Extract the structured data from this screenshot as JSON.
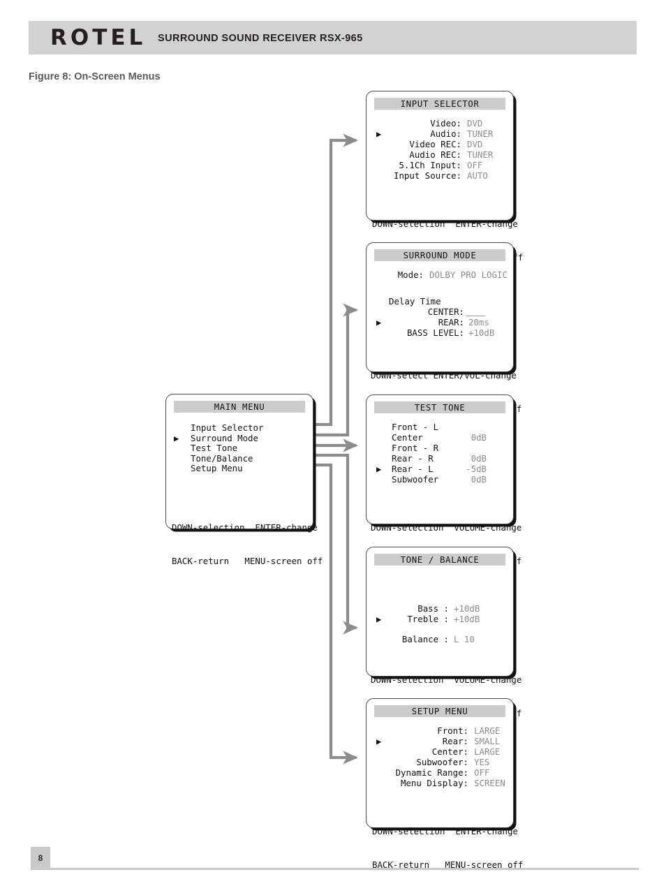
{
  "header": {
    "brand": "ROTEL",
    "model_line": "SURROUND SOUND RECEIVER  RSX-965"
  },
  "figure": {
    "caption": "Figure 8: On-Screen Menus"
  },
  "footer": {
    "page_number": "8"
  },
  "colors": {
    "header_band": "#d2d2d2",
    "title_band": "#cccccc",
    "value_text": "#8c8c8c",
    "label_text": "#111111",
    "connector": "#8c8c8c",
    "caption_text": "#58595b",
    "screen_border": "#4a4a4a",
    "screen_shadow": "#111111"
  },
  "icons": {
    "cursor": "▶",
    "arrowhead": "arrow-right-icon"
  },
  "menus": {
    "main": {
      "title": "MAIN MENU",
      "items": [
        {
          "label": "Input Selector",
          "selected": false
        },
        {
          "label": "Surround Mode",
          "selected": true
        },
        {
          "label": "Test Tone",
          "selected": false
        },
        {
          "label": "Tone/Balance",
          "selected": false
        },
        {
          "label": "Setup Menu",
          "selected": false
        }
      ],
      "footer": [
        "DOWN-selection  ENTER-change",
        "BACK-return   MENU-screen off"
      ]
    },
    "input_selector": {
      "title": "INPUT SELECTOR",
      "rows": [
        {
          "label": "Video:",
          "value": "DVD",
          "selected": false
        },
        {
          "label": "Audio:",
          "value": "TUNER",
          "selected": true
        },
        {
          "label": "Video REC:",
          "value": "DVD",
          "selected": false
        },
        {
          "label": "Audio REC:",
          "value": "TUNER",
          "selected": false
        },
        {
          "label": "5.1Ch Input:",
          "value": "OFF",
          "selected": false
        },
        {
          "label": "Input Source:",
          "value": "AUTO",
          "selected": false
        }
      ],
      "footer": [
        "DOWN-selection  ENTER-change",
        "BACK-return   MENU-screen off"
      ]
    },
    "surround_mode": {
      "title": "SURROUND MODE",
      "mode_label": "Mode:",
      "mode_value": "DOLBY PRO LOGIC",
      "delay_heading": "Delay Time",
      "rows": [
        {
          "label": "CENTER:",
          "value": "",
          "blank": true,
          "selected": false
        },
        {
          "label": "REAR:",
          "value": "20ms",
          "blank": false,
          "selected": true
        },
        {
          "label": "BASS LEVEL:",
          "value": "+10dB",
          "blank": false,
          "selected": false
        }
      ],
      "footer": [
        "DOWN-select ENTER/VOL-change",
        "BACK-return   MENU-screen off"
      ]
    },
    "test_tone": {
      "title": "TEST TONE",
      "rows": [
        {
          "label": "Front - L",
          "value": "",
          "selected": false
        },
        {
          "label": "Center",
          "value": "0dB",
          "selected": false
        },
        {
          "label": "Front - R",
          "value": "",
          "selected": false
        },
        {
          "label": "Rear - R",
          "value": "0dB",
          "selected": false
        },
        {
          "label": "Rear - L",
          "value": "-5dB",
          "selected": true
        },
        {
          "label": "Subwoofer",
          "value": "0dB",
          "selected": false
        }
      ],
      "footer": [
        "DOWN-selection  VOLUME-change",
        "BACK-return   MENU-screen off"
      ]
    },
    "tone_balance": {
      "title": "TONE / BALANCE",
      "rows": [
        {
          "label": "Bass :",
          "value": "+10dB",
          "selected": false
        },
        {
          "label": "Treble :",
          "value": "+10dB",
          "selected": true
        }
      ],
      "balance_label": "Balance :",
      "balance_value": "L 10",
      "footer": [
        "DOWN-selection  VOLUME-change",
        "BACK-return   MENU-screen off"
      ]
    },
    "setup": {
      "title": "SETUP MENU",
      "rows": [
        {
          "label": "Front:",
          "value": "LARGE",
          "selected": false
        },
        {
          "label": "Rear:",
          "value": "SMALL",
          "selected": true
        },
        {
          "label": "Center:",
          "value": "LARGE",
          "selected": false
        },
        {
          "label": "Subwoofer:",
          "value": "YES",
          "selected": false
        },
        {
          "label": "Dynamic Range:",
          "value": "OFF",
          "selected": false
        },
        {
          "label": "Menu Display:",
          "value": "SCREEN",
          "selected": false
        }
      ],
      "footer": [
        "DOWN-selection  ENTER-change",
        "BACK-return   MENU-screen off"
      ]
    }
  }
}
